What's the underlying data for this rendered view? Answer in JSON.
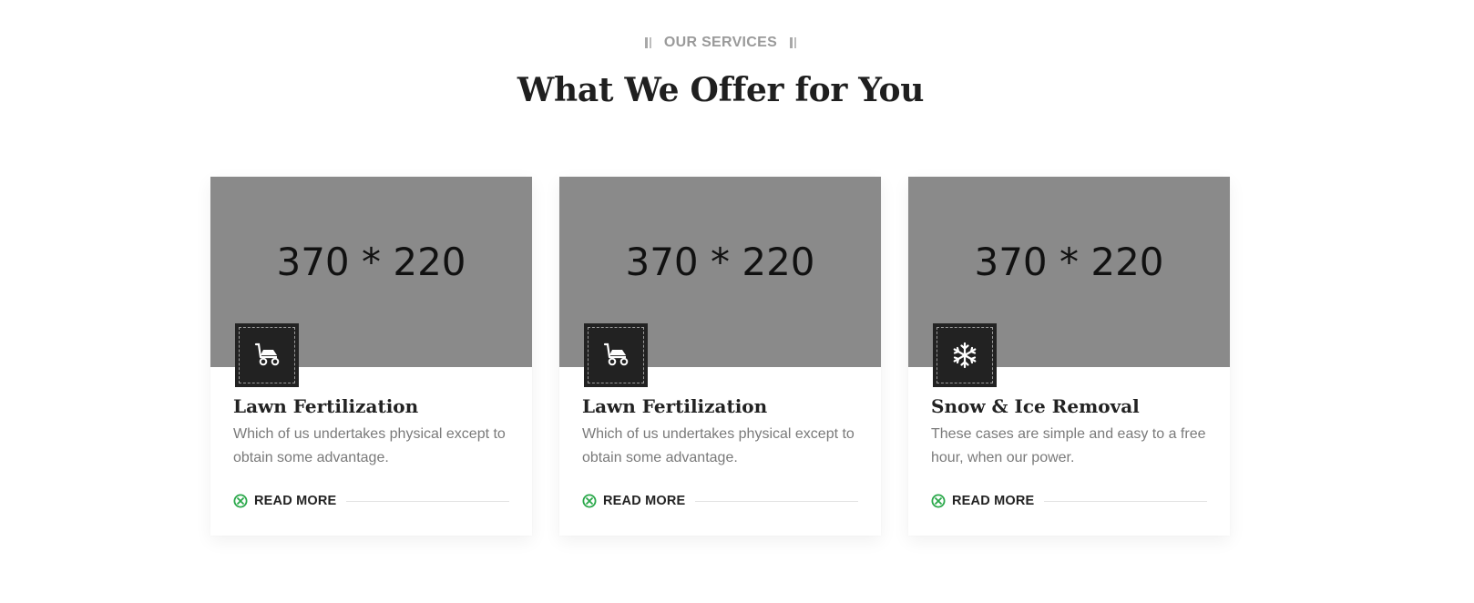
{
  "section": {
    "tagline": "OUR SERVICES",
    "title": "What We Offer for You"
  },
  "colors": {
    "accent_green": "#2aa84a",
    "dark": "#222222",
    "placeholder_gray": "#8a8a8a"
  },
  "cards": [
    {
      "image_label": "370 * 220",
      "icon": "lawn-mower-icon",
      "title": "Lawn Fertilization",
      "description": "Which of us undertakes physical except to obtain some advantage.",
      "link_label": "READ MORE"
    },
    {
      "image_label": "370 * 220",
      "icon": "lawn-mower-icon",
      "title": "Lawn Fertilization",
      "description": "Which of us undertakes physical except to obtain some advantage.",
      "link_label": "READ MORE"
    },
    {
      "image_label": "370 * 220",
      "icon": "snowflake-icon",
      "title": "Snow & Ice Removal",
      "description": "These cases are simple and easy to a free hour, when our power.",
      "link_label": "READ MORE"
    }
  ]
}
